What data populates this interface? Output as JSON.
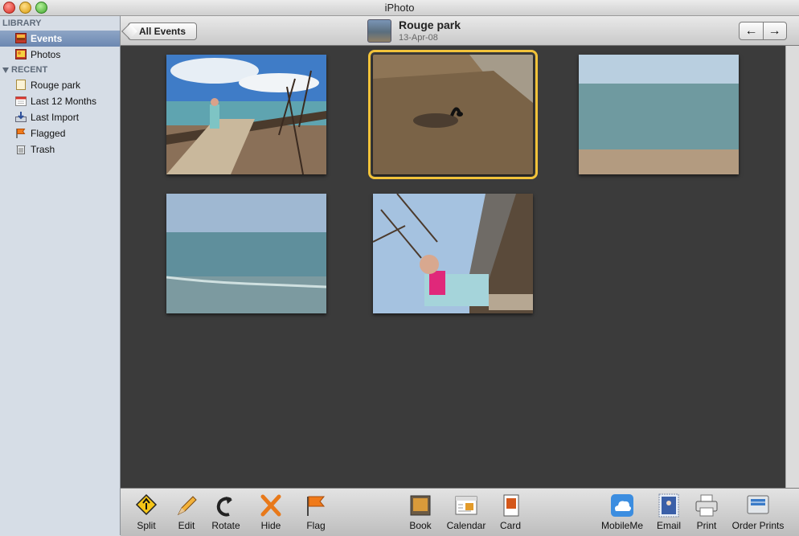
{
  "window": {
    "title": "iPhoto"
  },
  "sidebar": {
    "library_header": "LIBRARY",
    "library_items": [
      {
        "label": "Events",
        "icon": "events-icon",
        "selected": true
      },
      {
        "label": "Photos",
        "icon": "photos-icon",
        "selected": false
      }
    ],
    "recent_header": "RECENT",
    "recent_items": [
      {
        "label": "Rouge park",
        "icon": "event-album-icon"
      },
      {
        "label": "Last 12 Months",
        "icon": "calendar-icon"
      },
      {
        "label": "Last Import",
        "icon": "import-icon"
      },
      {
        "label": "Flagged",
        "icon": "flag-icon"
      },
      {
        "label": "Trash",
        "icon": "trash-icon"
      }
    ]
  },
  "toolbar": {
    "back_label": "All Events",
    "event_title": "Rouge park",
    "event_date": "13-Apr-08",
    "prev_icon": "left-arrow-icon",
    "next_icon": "right-arrow-icon"
  },
  "photos": [
    {
      "name": "boardwalk-person",
      "selected": false
    },
    {
      "name": "goose-on-grass",
      "selected": true
    },
    {
      "name": "lake-shore",
      "selected": false
    },
    {
      "name": "lake-waves",
      "selected": false
    },
    {
      "name": "person-tree-rotated",
      "selected": false
    }
  ],
  "bottom_tools_left": [
    {
      "label": "Split",
      "icon": "split-icon"
    },
    {
      "label": "Edit",
      "icon": "edit-pencil-icon"
    },
    {
      "label": "Rotate",
      "icon": "rotate-icon"
    },
    {
      "label": "Hide",
      "icon": "hide-x-icon"
    },
    {
      "label": "Flag",
      "icon": "flag-icon"
    }
  ],
  "bottom_tools_mid": [
    {
      "label": "Book",
      "icon": "book-icon"
    },
    {
      "label": "Calendar",
      "icon": "calendar-icon"
    },
    {
      "label": "Card",
      "icon": "card-icon"
    }
  ],
  "bottom_tools_right": [
    {
      "label": "MobileMe",
      "icon": "mobileme-cloud-icon"
    },
    {
      "label": "Email",
      "icon": "email-stamp-icon"
    },
    {
      "label": "Print",
      "icon": "printer-icon"
    },
    {
      "label": "Order Prints",
      "icon": "order-prints-icon"
    }
  ],
  "colors": {
    "selection_highlight": "#f2c33a",
    "grid_background": "#3b3b3b"
  }
}
